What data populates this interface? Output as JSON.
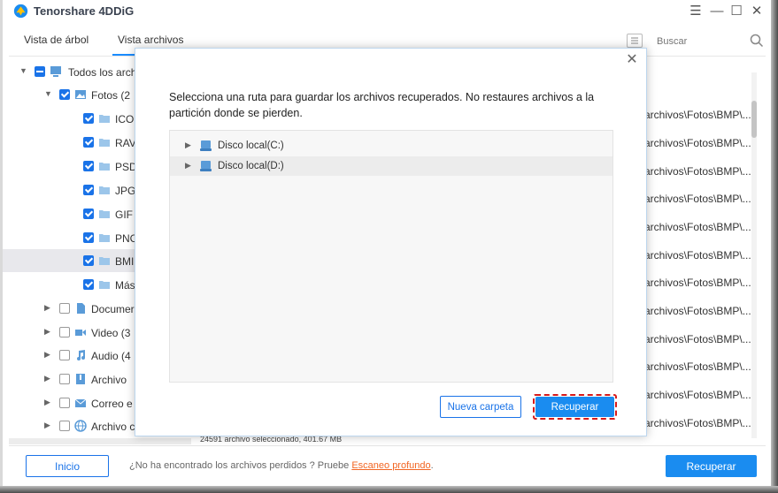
{
  "app": {
    "title": "Tenorshare 4DDiG"
  },
  "window_controls": {
    "menu": "☰",
    "minimize": "—",
    "maximize": "☐",
    "close": "✕"
  },
  "tabs": [
    {
      "label": "Vista de árbol"
    },
    {
      "label": "Vista archivos"
    }
  ],
  "search": {
    "placeholder": "Buscar"
  },
  "tree": [
    {
      "label": "Todos los arch",
      "state": "partial"
    },
    {
      "label": "Fotos  (2",
      "state": "checked"
    },
    {
      "label": "ICO",
      "state": "checked"
    },
    {
      "label": "RAV",
      "state": "checked"
    },
    {
      "label": "PSD",
      "state": "checked"
    },
    {
      "label": "JPG",
      "state": "checked"
    },
    {
      "label": "GIF",
      "state": "checked"
    },
    {
      "label": "PNC",
      "state": "checked"
    },
    {
      "label": "BMI",
      "state": "checked"
    },
    {
      "label": "Más",
      "state": "checked"
    },
    {
      "label": "Documer",
      "state": "empty"
    },
    {
      "label": "Video  (3",
      "state": "empty"
    },
    {
      "label": "Audio  (4",
      "state": "empty"
    },
    {
      "label": "Archivo",
      "state": "empty"
    },
    {
      "label": "Correo e",
      "state": "empty"
    },
    {
      "label": "Archivo c",
      "state": "empty"
    }
  ],
  "paths": [
    "archivos\\Fotos\\BMP\\...",
    "archivos\\Fotos\\BMP\\...",
    "archivos\\Fotos\\BMP\\...",
    "archivos\\Fotos\\BMP\\...",
    "archivos\\Fotos\\BMP\\...",
    "archivos\\Fotos\\BMP\\...",
    "archivos\\Fotos\\BMP\\...",
    "archivos\\Fotos\\BMP\\...",
    "archivos\\Fotos\\BMP\\...",
    "archivos\\Fotos\\BMP\\...",
    "archivos\\Fotos\\BMP\\...",
    "archivos\\Fotos\\BMP\\..."
  ],
  "status": {
    "text": "24591 archivo seleccionado, 401.67 MB"
  },
  "bottom": {
    "inicio_label": "Inicio",
    "hint_prefix": "¿No ha encontrado los archivos perdidos ? Pruebe ",
    "hint_link": "Escaneo profundo",
    "hint_suffix": ".",
    "recuperar_label": "Recuperar"
  },
  "modal": {
    "close": "✕",
    "message": "Selecciona una ruta para guardar los archivos recuperados. No restaures archivos a la partición donde se pierden.",
    "drives": [
      {
        "label": "Disco local(C:)"
      },
      {
        "label": "Disco local(D:)"
      }
    ],
    "nueva_carpeta_label": "Nueva carpeta",
    "recuperar_label": "Recuperar"
  },
  "colors": {
    "accent": "#1a8cf0",
    "checkbox": "#1a73e8",
    "link": "#f26522",
    "highlight_outline": "#d71a1a"
  }
}
